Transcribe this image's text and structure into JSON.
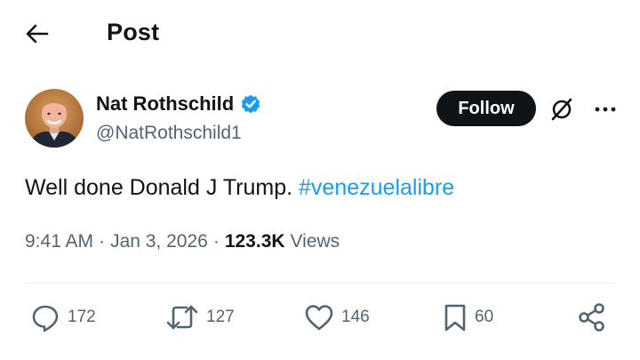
{
  "header": {
    "title": "Post",
    "back_icon": "arrow-left-icon"
  },
  "author": {
    "display_name": "Nat Rothschild",
    "handle": "@NatRothschild1",
    "verified": true,
    "verified_color": "#1d9bf0",
    "avatar_icon": "avatar"
  },
  "buttons": {
    "follow_label": "Follow",
    "grok_icon": "grok-icon",
    "more_icon": "more-icon"
  },
  "tweet": {
    "text": "Well done Donald J Trump.",
    "hashtag": "#venezuelalibre"
  },
  "meta": {
    "time": "9:41 AM",
    "date": "Jan 3, 2026",
    "separator": "·",
    "views_count": "123.3K",
    "views_label": "Views"
  },
  "actions": {
    "replies": "172",
    "reposts": "127",
    "likes": "146",
    "bookmarks": "60"
  },
  "colors": {
    "text": "#0f1419",
    "secondary": "#536471",
    "link": "#1d9bf0",
    "divider": "#eff3f4"
  }
}
